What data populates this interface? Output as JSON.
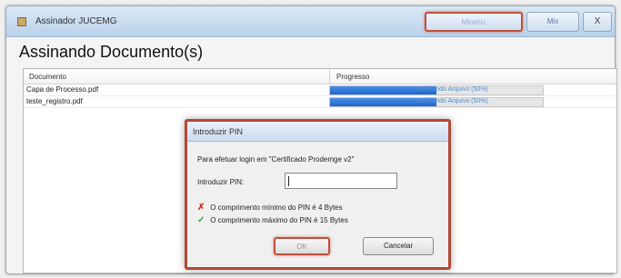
{
  "window": {
    "title": "Assinador JUCEMG",
    "background_title": "",
    "controls": {
      "minimize": "Minimiz",
      "maximize": "Mix",
      "close": "X"
    }
  },
  "heading": "Assinando Documento(s)",
  "table": {
    "columns": [
      "Documento",
      "Progresso"
    ],
    "rows": [
      {
        "document": "Capa de Processo.pdf",
        "progress_text": "assinando Arquivo (50%)",
        "progress": 0.5
      },
      {
        "document": "teste_registro.pdf",
        "progress_text": "assinando Arquivo (50%)",
        "progress": 0.5
      }
    ]
  },
  "dialog": {
    "title": "Introduzir PIN",
    "prompt": "Para efetuar login em \"Certificado Prodemge v2\"",
    "pin_label": "Introduzir PIN:",
    "pin_value": "",
    "rules": [
      {
        "status": "fail",
        "icon": "x-icon",
        "text": "O comprimento mínimo do PIN é 4 Bytes"
      },
      {
        "status": "ok",
        "icon": "checkmark-icon",
        "text": "O comprimento máximo do PIN é 15 Bytes"
      }
    ],
    "ok_label": "OK",
    "cancel_label": "Cancelar"
  },
  "colors": {
    "accent_highlight": "#c0503c",
    "progress": "#2a70d8",
    "fail": "#d03030",
    "ok": "#36a836"
  }
}
